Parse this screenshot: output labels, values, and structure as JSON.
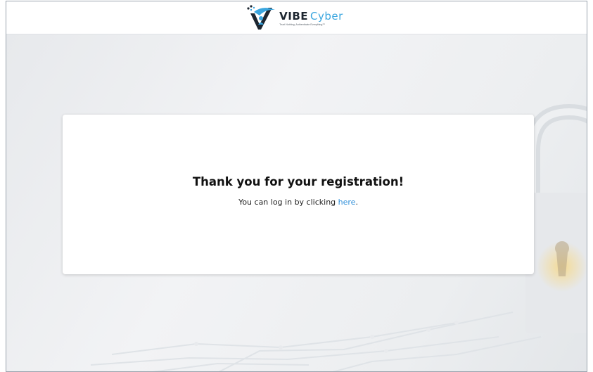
{
  "header": {
    "brand_name": "VIBE",
    "brand_suffix": "Cyber",
    "tagline": "Trust Nothing, Authenticate Everything™"
  },
  "message": {
    "title": "Thank you for your registration!",
    "body_prefix": "You can log in by clicking ",
    "link_text": "here",
    "body_suffix": "."
  },
  "colors": {
    "brand_blue": "#3aa6df",
    "link": "#2f8fd9",
    "card_bg": "#ffffff",
    "page_bg": "#eef0f2"
  },
  "icons": {
    "logo": "vibe-cyber-logo-icon",
    "background": "padlock-circuit-background"
  }
}
